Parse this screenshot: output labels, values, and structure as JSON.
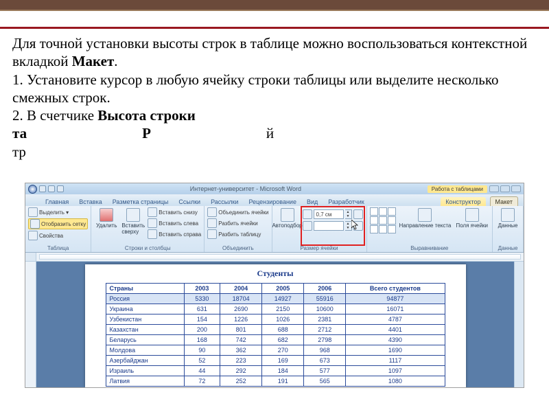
{
  "instruction": {
    "p1a": "Для точной установки высоты строк в таблице можно воспользоваться контекстной вкладкой ",
    "p1b": "Макет",
    "p1c": ".",
    "p2": "1. Установите курсор в любую ячейку строки таблицы или выделите несколько смежных строк.",
    "p3a": "2. В счетчике ",
    "p3b": "Высота строки",
    "p4a": "та",
    "p4b": "Р",
    "p4c": "й",
    "p5": "тр"
  },
  "word": {
    "title": "Интернет-университет - Microsoft Word",
    "context_title": "Работа с таблицами",
    "tabs": [
      "Главная",
      "Вставка",
      "Разметка страницы",
      "Ссылки",
      "Рассылки",
      "Рецензирование",
      "Вид",
      "Разработчик"
    ],
    "ctx_tabs": [
      "Конструктор",
      "Макет"
    ],
    "ribbon": {
      "g1": {
        "label": "Таблица",
        "select": "Выделить ▾",
        "grid": "Отобразить сетку",
        "props": "Свойства"
      },
      "g2": {
        "label": "Строки и столбцы",
        "delete": "Удалить",
        "ins_top": "Вставить снизу",
        "ins_left": "Вставить слева",
        "ins_right": "Вставить справа",
        "ins_above": "Вставить сверху"
      },
      "g3": {
        "label": "Объединить",
        "merge": "Объединить ячейки",
        "split": "Разбить ячейки",
        "split_tbl": "Разбить таблицу"
      },
      "g4": {
        "label": "Размер ячейки",
        "autofit": "Автоподбор",
        "height": "0,7 см",
        "width": ""
      },
      "g5": {
        "label": "Выравнивание",
        "dir": "Направление текста",
        "margins": "Поля ячейки"
      },
      "g6": {
        "label": "Данные",
        "data": "Данные"
      }
    },
    "doc": {
      "title": "Студенты",
      "headers": [
        "Страны",
        "2003",
        "2004",
        "2005",
        "2006",
        "Всего студентов"
      ],
      "rows": [
        [
          "Россия",
          "5330",
          "18704",
          "14927",
          "55916",
          "94877"
        ],
        [
          "Украина",
          "631",
          "2690",
          "2150",
          "10600",
          "16071"
        ],
        [
          "Узбекистан",
          "154",
          "1226",
          "1026",
          "2381",
          "4787"
        ],
        [
          "Казахстан",
          "200",
          "801",
          "688",
          "2712",
          "4401"
        ],
        [
          "Беларусь",
          "168",
          "742",
          "682",
          "2798",
          "4390"
        ],
        [
          "Молдова",
          "90",
          "362",
          "270",
          "968",
          "1690"
        ],
        [
          "Азербайджан",
          "52",
          "223",
          "169",
          "673",
          "1117"
        ],
        [
          "Израиль",
          "44",
          "292",
          "184",
          "577",
          "1097"
        ],
        [
          "Латвия",
          "72",
          "252",
          "191",
          "565",
          "1080"
        ]
      ]
    }
  }
}
